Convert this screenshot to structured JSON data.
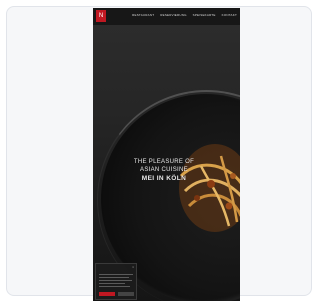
{
  "screenshot": {
    "logo_text": "N",
    "nav": [
      "RESTAURANT",
      "RESERVIERUNG",
      "SPEISEKARTE",
      "KONTAKT"
    ],
    "hero": {
      "line1": "THE PLEASURE OF",
      "line2": "ASIAN CUISINE",
      "line3": "MEI IN KÖLN",
      "subtitle": ""
    },
    "cookie": {
      "title": "",
      "accept_label": "",
      "settings_label": ""
    }
  },
  "colors": {
    "accent": "#c01822",
    "background": "#1c1c1c",
    "card": "#f6f7f9"
  }
}
